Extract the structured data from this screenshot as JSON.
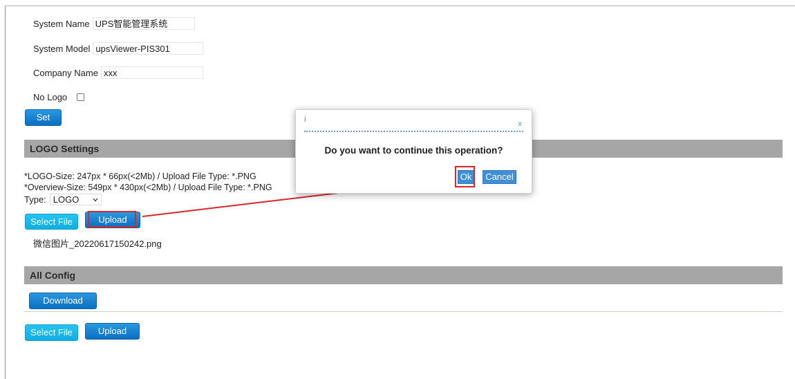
{
  "system": {
    "name_label": "System Name",
    "name_value": "UPS智能管理系统",
    "model_label": "System Model",
    "model_value": "upsViewer-PIS301",
    "company_label": "Company Name",
    "company_value": "xxx",
    "nologo_label": "No Logo",
    "nologo_checked": false,
    "set_button": "Set"
  },
  "logo_settings": {
    "title": "LOGO Settings",
    "note_logo": "*LOGO-Size: 247px * 66px(<2Mb) / Upload File Type: *.PNG",
    "note_overview": "*Overview-Size: 549px * 430px(<2Mb) / Upload File Type: *.PNG",
    "type_label": "Type:",
    "type_value": "LOGO",
    "select_file_button": "Select File",
    "upload_button": "Upload",
    "selected_file": "微信图片_20220617150242.png"
  },
  "all_config": {
    "title": "All Config",
    "download_button": "Download",
    "select_file_button": "Select File",
    "upload_button": "Upload"
  },
  "dialog": {
    "title": "i",
    "close": "x",
    "message": "Do you want to continue this operation?",
    "ok_button": "Ok",
    "cancel_button": "Cancel"
  },
  "colors": {
    "section_bar": "#a6a6a6",
    "primary_button": "#0b6fc2",
    "select_button": "#10aee0",
    "annotation": "#d8262a"
  }
}
